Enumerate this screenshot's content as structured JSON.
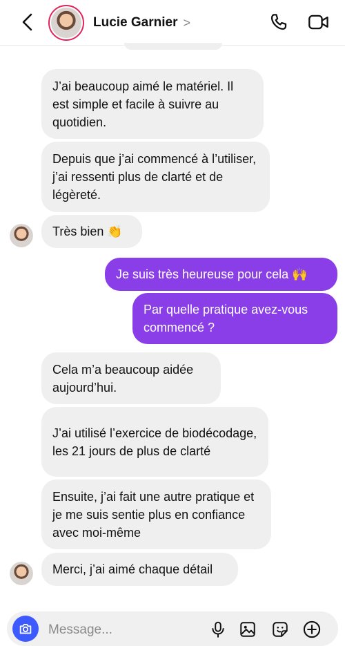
{
  "header": {
    "contact_name": "Lucie Garnier",
    "chevron": ">",
    "icons": {
      "back": "chevron-left-icon",
      "call": "phone-icon",
      "video": "video-camera-icon"
    }
  },
  "messages": [
    {
      "from": "them",
      "text": "J’ai beaucoup aimé le matériel. Il est simple et facile à suivre au quotidien."
    },
    {
      "from": "them",
      "text": "Depuis que j’ai commencé à l’utiliser, j’ai ressenti plus de clarté et de légèreté."
    },
    {
      "from": "them",
      "text": "Très bien 👏"
    },
    {
      "from": "me",
      "text": "Je suis très heureuse pour cela 🙌"
    },
    {
      "from": "me",
      "text": "Par quelle pratique avez-vous commencé ?"
    },
    {
      "from": "them",
      "text": "Cela m’a beaucoup aidée aujourd’hui."
    },
    {
      "from": "them",
      "text": "J’ai utilisé l’exercice de biodécodage, les 21 jours de plus de clarté"
    },
    {
      "from": "them",
      "text": "Ensuite, j’ai fait une autre pratique et je me suis sentie plus en confiance avec moi-même"
    },
    {
      "from": "them",
      "text": "Merci, j’ai aimé chaque détail"
    }
  ],
  "composer": {
    "placeholder": "Message...",
    "icons": [
      "camera-icon",
      "microphone-icon",
      "image-icon",
      "sticker-icon",
      "plus-circle-icon"
    ]
  },
  "colors": {
    "outgoing": "#8a3ee8",
    "incoming": "#efefef",
    "camera_button": "#3d5afe"
  }
}
